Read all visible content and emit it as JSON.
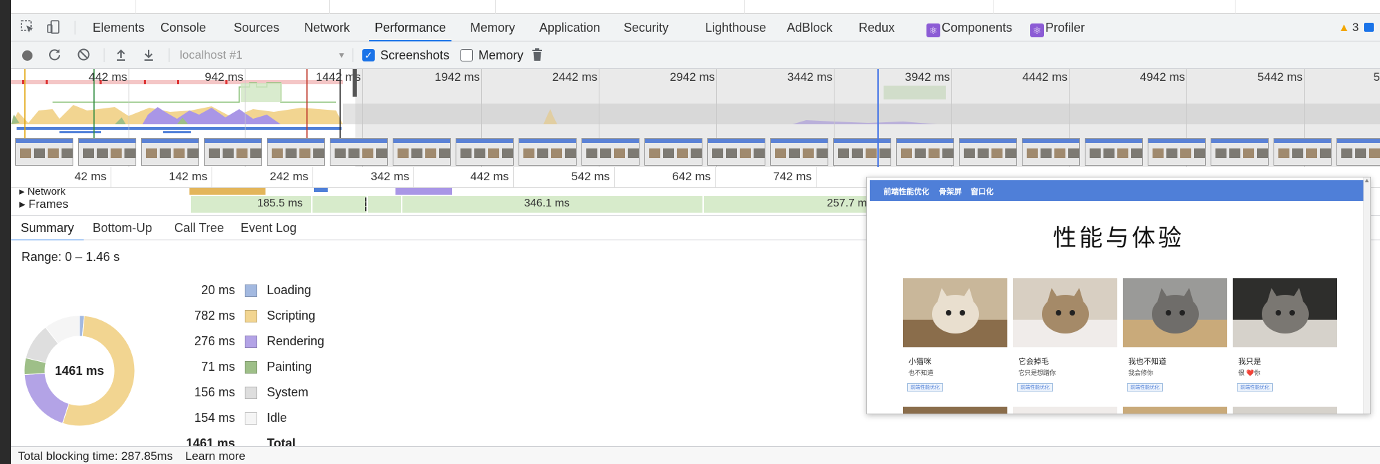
{
  "devtools": {
    "tabs": [
      {
        "label": "Elements"
      },
      {
        "label": "Console"
      },
      {
        "label": "Sources"
      },
      {
        "label": "Network"
      },
      {
        "label": "Performance",
        "active": true
      },
      {
        "label": "Memory"
      },
      {
        "label": "Application"
      },
      {
        "label": "Security"
      },
      {
        "label": "Lighthouse"
      },
      {
        "label": "AdBlock"
      },
      {
        "label": "Redux"
      },
      {
        "label": "Components",
        "icon": "react-icon"
      },
      {
        "label": "Profiler",
        "icon": "react-icon"
      }
    ],
    "warnings_count": "3",
    "accent_color": "#1a73e8"
  },
  "perf_toolbar": {
    "target_select": "localhost #1",
    "screenshots_label": "Screenshots",
    "screenshots_checked": true,
    "memory_label": "Memory",
    "memory_checked": false
  },
  "overview": {
    "ruler_labels": [
      "442 ms",
      "942 ms",
      "1442 ms",
      "1942 ms",
      "2442 ms",
      "2942 ms",
      "3442 ms",
      "3942 ms",
      "4442 ms",
      "4942 ms",
      "5442 ms",
      "5"
    ]
  },
  "timeline": {
    "ruler_labels": [
      "42 ms",
      "142 ms",
      "242 ms",
      "342 ms",
      "442 ms",
      "542 ms",
      "642 ms",
      "742 ms"
    ],
    "network_track_label": "Network",
    "frames_track_label": "Frames",
    "frame_durations": [
      "185.5 ms",
      "346.1 ms",
      "257.7 m"
    ]
  },
  "bottom_panel": {
    "tabs": [
      {
        "label": "Summary",
        "active": true
      },
      {
        "label": "Bottom-Up"
      },
      {
        "label": "Call Tree"
      },
      {
        "label": "Event Log"
      }
    ],
    "range": "Range: 0 – 1.46 s",
    "total_center": "1461 ms",
    "categories": [
      {
        "value": "20 ms",
        "label": "Loading",
        "ms": 20,
        "color": "#a3b9e0"
      },
      {
        "value": "782 ms",
        "label": "Scripting",
        "ms": 782,
        "color": "#f2d591"
      },
      {
        "value": "276 ms",
        "label": "Rendering",
        "ms": 276,
        "color": "#b3a3e6"
      },
      {
        "value": "71 ms",
        "label": "Painting",
        "ms": 71,
        "color": "#9ebf88"
      },
      {
        "value": "156 ms",
        "label": "System",
        "ms": 156,
        "color": "#dedede"
      },
      {
        "value": "154 ms",
        "label": "Idle",
        "ms": 154,
        "color": "#f5f5f5"
      }
    ],
    "total_row": {
      "value": "1461 ms",
      "label": "Total"
    }
  },
  "status": {
    "text": "Total blocking time: 287.85ms",
    "link": "Learn more"
  },
  "screenshot_popover": {
    "nav_items": [
      "前端性能优化",
      "骨架屏",
      "窗口化"
    ],
    "title": "性能与体验",
    "cards": [
      {
        "name": "小猫咪",
        "desc": "也不知道",
        "tag": "前端性能优化"
      },
      {
        "name": "它会掉毛",
        "desc": "它只是想蹭你",
        "tag": "前端性能优化"
      },
      {
        "name": "我也不知道",
        "desc": "我会修你",
        "tag": "前端性能优化"
      },
      {
        "name": "我只是",
        "desc": "很 ❤️你",
        "tag": "前端性能优化"
      }
    ]
  }
}
